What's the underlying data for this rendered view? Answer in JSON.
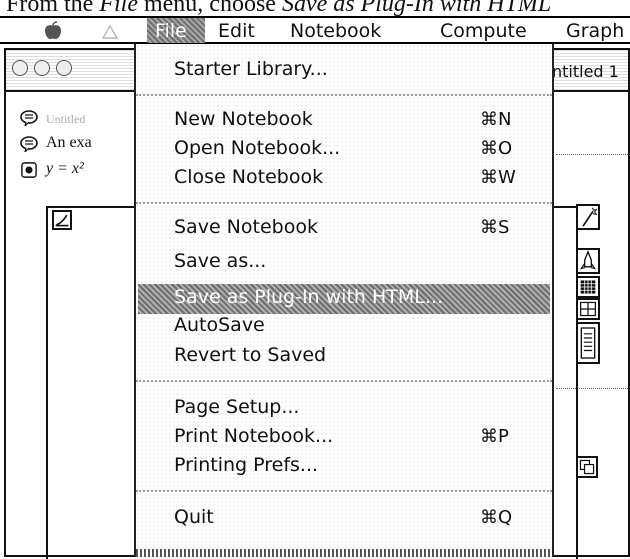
{
  "caption": {
    "prefix": "From the ",
    "menu_name": "File",
    "middle": " menu, choose ",
    "command": "Save as Plug-In with HTML"
  },
  "menubar": {
    "items": [
      "File",
      "Edit",
      "Notebook",
      "Compute",
      "Graph"
    ]
  },
  "window": {
    "title": "ntitled 1"
  },
  "notebook": {
    "row1_text": "Untitled",
    "row2_text": "An exa",
    "row3_text": "y = x²"
  },
  "file_menu": {
    "starter_library": "Starter Library...",
    "new_notebook": "New Notebook",
    "new_notebook_shortcut": "⌘N",
    "open_notebook": "Open Notebook...",
    "open_notebook_shortcut": "⌘O",
    "close_notebook": "Close Notebook",
    "close_notebook_shortcut": "⌘W",
    "save_notebook": "Save Notebook",
    "save_notebook_shortcut": "⌘S",
    "save_as": "Save as...",
    "save_as_plugin": "Save as Plug-In with HTML...",
    "autosave": "AutoSave",
    "revert": "Revert to Saved",
    "page_setup": "Page Setup...",
    "print_notebook": "Print Notebook...",
    "print_notebook_shortcut": "⌘P",
    "printing_prefs": "Printing Prefs...",
    "quit": "Quit",
    "quit_shortcut": "⌘Q"
  }
}
